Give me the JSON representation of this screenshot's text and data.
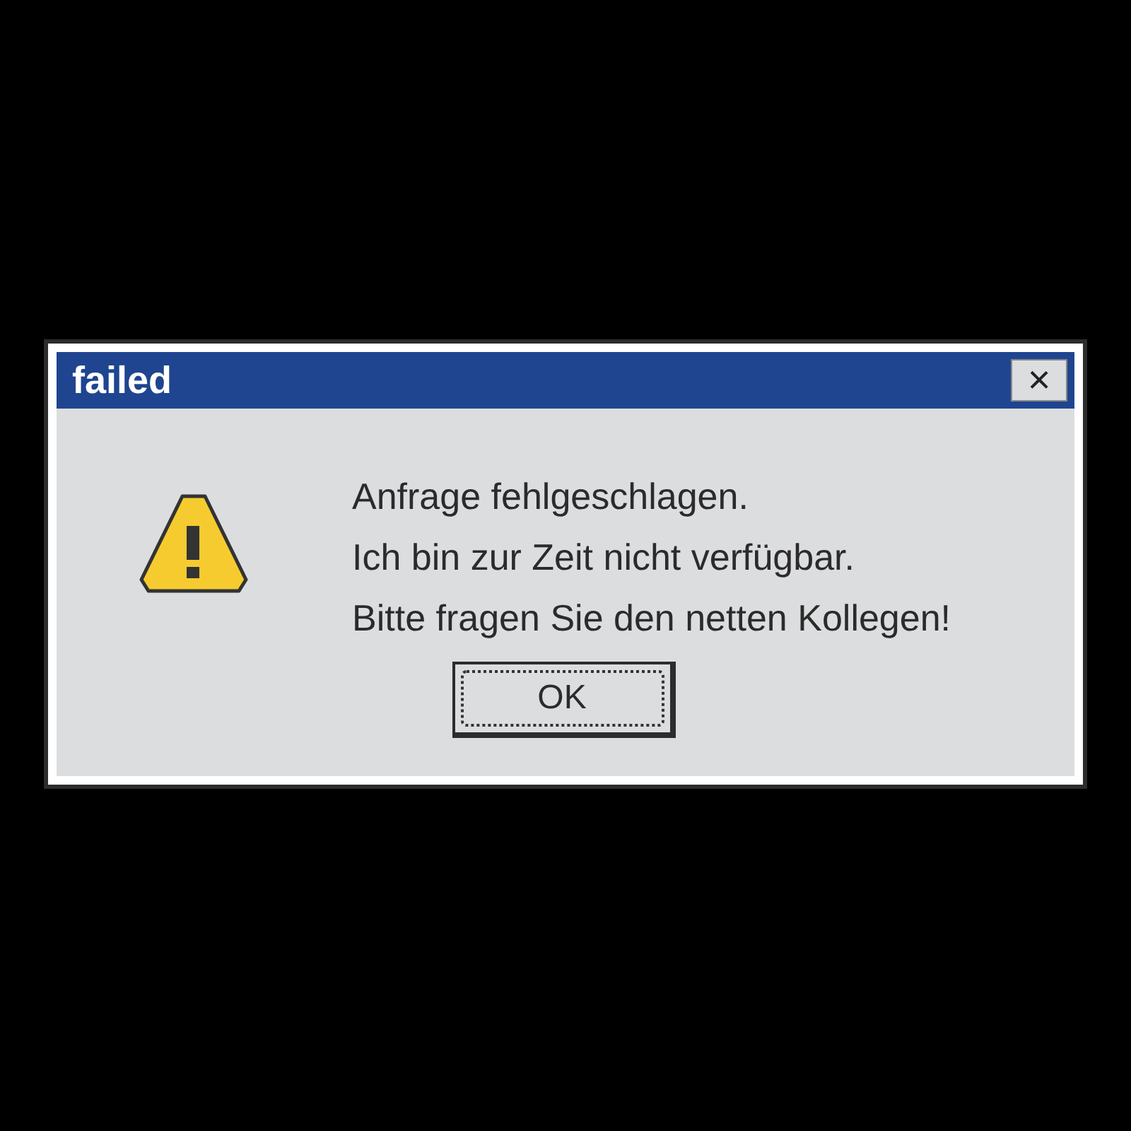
{
  "window": {
    "title": "failed",
    "close": "×"
  },
  "message": [
    "Anfrage fehlgeschlagen.",
    "Ich bin zur Zeit nicht verfügbar.",
    "Bitte fragen Sie den netten Kollegen!"
  ],
  "buttons": [
    {
      "label": "OK",
      "focused": true
    }
  ]
}
